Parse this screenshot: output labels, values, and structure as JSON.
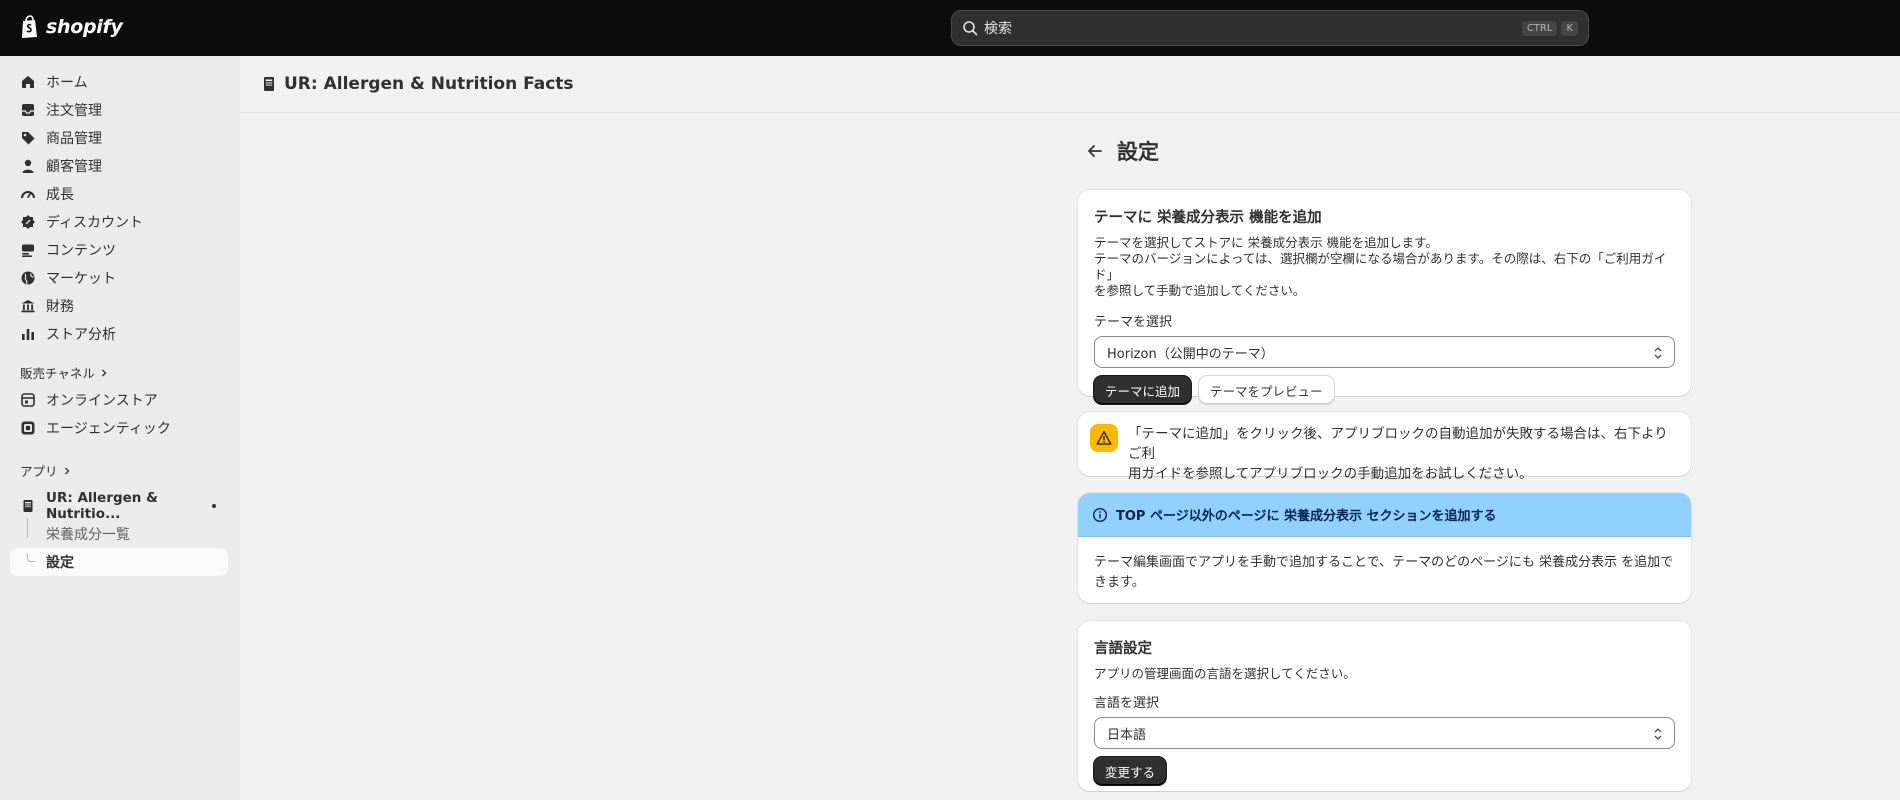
{
  "topbar": {
    "brand": "shopify",
    "search_placeholder": "検索",
    "shortcut_key1": "CTRL",
    "shortcut_key2": "K"
  },
  "sidebar": {
    "items": [
      {
        "label": "ホーム",
        "icon": "home-icon"
      },
      {
        "label": "注文管理",
        "icon": "inbox-icon"
      },
      {
        "label": "商品管理",
        "icon": "tag-icon"
      },
      {
        "label": "顧客管理",
        "icon": "person-icon"
      },
      {
        "label": "成長",
        "icon": "gauge-icon"
      },
      {
        "label": "ディスカウント",
        "icon": "discount-icon"
      },
      {
        "label": "コンテンツ",
        "icon": "content-icon"
      },
      {
        "label": "マーケット",
        "icon": "globe-icon"
      },
      {
        "label": "財務",
        "icon": "bank-icon"
      },
      {
        "label": "ストア分析",
        "icon": "bar-chart-icon"
      }
    ],
    "sales_channels_label": "販売チャネル",
    "channels": [
      {
        "label": "オンラインストア",
        "icon": "store-icon"
      },
      {
        "label": "エージェンティック",
        "icon": "agentic-icon"
      }
    ],
    "apps_label": "アプリ",
    "app_item_label": "UR: Allergen & Nutritio...",
    "app_sub_items": [
      {
        "label": "栄養成分一覧"
      },
      {
        "label": "設定"
      }
    ]
  },
  "main": {
    "app_title": "UR: Allergen & Nutrition Facts",
    "page_title": "設定",
    "theme_card": {
      "title": "テーマに 栄養成分表示 機能を追加",
      "line1": "テーマを選択してストアに 栄養成分表示 機能を追加します。",
      "line2": "テーマのバージョンによっては、選択欄が空欄になる場合があります。その際は、右下の「ご利用ガイド」",
      "line3": "を参照して手動で追加してください。",
      "select_label": "テーマを選択",
      "select_value": "Horizon（公開中のテーマ）",
      "add_button": "テーマに追加",
      "preview_button": "テーマをプレビュー"
    },
    "warning_card": {
      "line1": "「テーマに追加」をクリック後、アプリブロックの自動追加が失敗する場合は、右下よりご利",
      "line2": "用ガイドを参照してアプリブロックの手動追加をお試しください。"
    },
    "info_card": {
      "header": "TOP ページ以外のページに 栄養成分表示 セクションを追加する",
      "line1": "テーマ編集画面でアプリを手動で追加することで、テーマのどのページにも 栄養成分表示 を追加で",
      "line2": "きます。"
    },
    "language_card": {
      "title": "言語設定",
      "description": "アプリの管理画面の言語を選択してください。",
      "select_label": "言語を選択",
      "select_value": "日本語",
      "change_button": "変更する"
    }
  }
}
